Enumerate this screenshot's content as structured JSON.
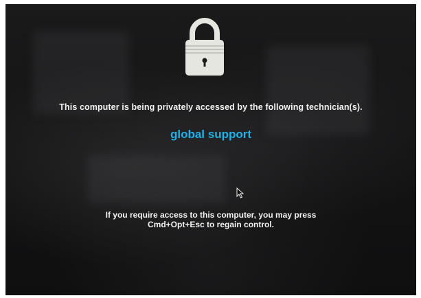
{
  "screen": {
    "lock_icon": "padlock-icon",
    "message": "This computer is being privately accessed by the following technician(s).",
    "technician_name": "global support",
    "instructions": {
      "line1": "If you require access to this computer, you may press",
      "line2": "Cmd+Opt+Esc to regain control."
    },
    "cursor_icon": "mouse-pointer-icon"
  },
  "colors": {
    "background": "#141415",
    "text": "#f2f2f2",
    "accent": "#1fb1e8",
    "lock": "#e6e6e0"
  }
}
